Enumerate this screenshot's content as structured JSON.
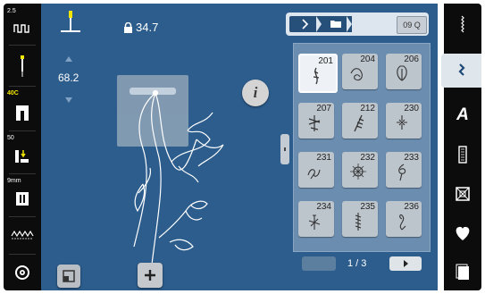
{
  "left_toolbar": {
    "stitch_width_value": "2.5",
    "presser_foot_label": "40C",
    "foot_pressure_value": "50",
    "stitch_length_value": "9mm"
  },
  "main": {
    "lock_value": "34.7",
    "needle_position_value": "68.2",
    "info_label": "i"
  },
  "stitch_header": {
    "search_label": "09 Q"
  },
  "stitches": [
    {
      "number": "201",
      "selected": true
    },
    {
      "number": "204",
      "selected": false
    },
    {
      "number": "206",
      "selected": false
    },
    {
      "number": "207",
      "selected": false
    },
    {
      "number": "212",
      "selected": false
    },
    {
      "number": "230",
      "selected": false
    },
    {
      "number": "231",
      "selected": false
    },
    {
      "number": "232",
      "selected": false
    },
    {
      "number": "233",
      "selected": false
    },
    {
      "number": "234",
      "selected": false
    },
    {
      "number": "235",
      "selected": false
    },
    {
      "number": "236",
      "selected": false
    }
  ],
  "pager": {
    "label": "1 / 3"
  },
  "right_toolbar": {
    "alphabet_label": "A"
  },
  "colors": {
    "main_blue": "#2c5d8d",
    "toolbar_black": "#0c0c0c",
    "accent_yellow": "#f2e600"
  }
}
